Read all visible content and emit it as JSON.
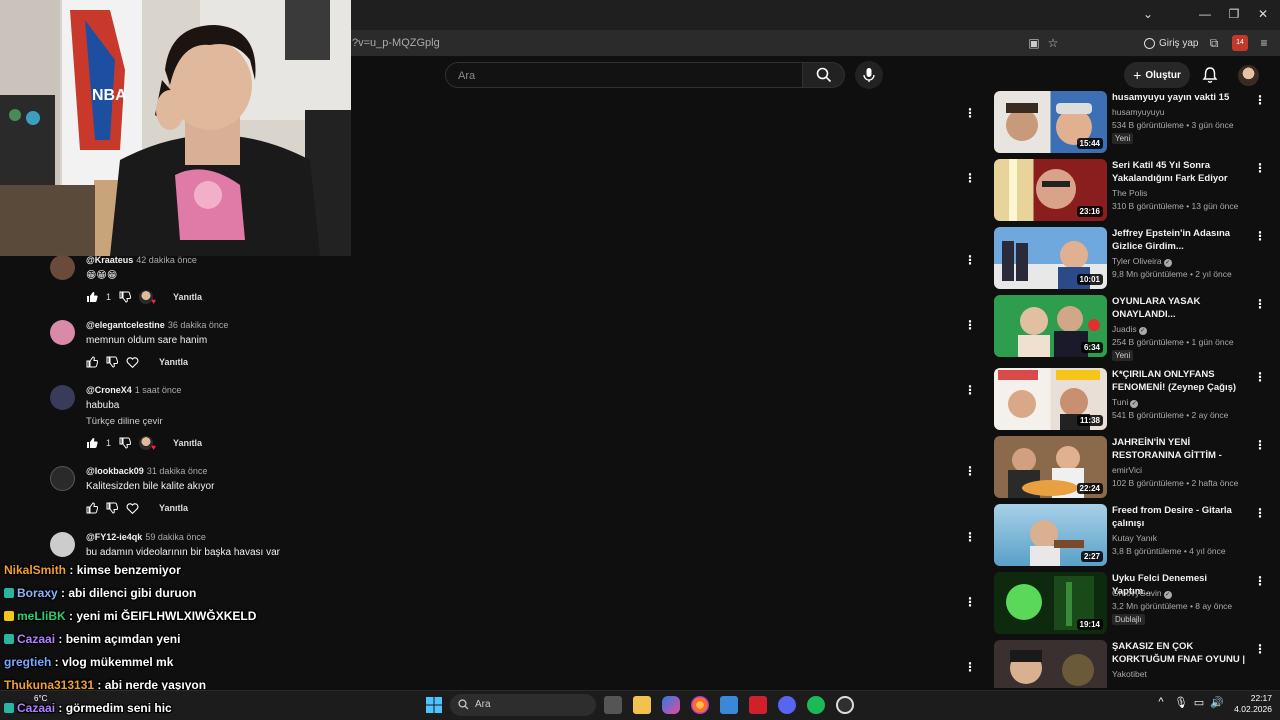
{
  "browser": {
    "url": "?v=u_p-MQZGplg",
    "signin_label": "Giriş yap",
    "extension_badge": "14"
  },
  "youtube": {
    "search_placeholder": "Ara",
    "create_label": "Oluştur"
  },
  "comments": [
    {
      "author": "@Kraateus",
      "time": "42 dakika önce",
      "text": "😁😁😁",
      "text2": "",
      "likes": "1",
      "reply_label": "Yanıtla",
      "creator_heart": true,
      "avatar_color": "#6a4a3a"
    },
    {
      "author": "@elegantcelestine",
      "time": "36 dakika önce",
      "text": "memnun oldum sare hanim",
      "text2": "",
      "likes": "",
      "reply_label": "Yanıtla",
      "creator_heart": false,
      "avatar_color": "#d98aa8"
    },
    {
      "author": "@CroneX4",
      "time": "1 saat önce",
      "text": "habuba",
      "text2": "Türkçe diline çevir",
      "likes": "1",
      "reply_label": "Yanıtla",
      "creator_heart": true,
      "avatar_color": "#3a3a5a"
    },
    {
      "author": "@lookback09",
      "time": "31 dakika önce",
      "text": "Kalitesizden bile kalite akıyor",
      "text2": "",
      "likes": "",
      "reply_label": "Yanıtla",
      "creator_heart": false,
      "avatar_color": "#2a2a2a"
    },
    {
      "author": "@FY12-ie4qk",
      "time": "59 dakika önce",
      "text": "bu adamın videolarının bir başka havası var",
      "text2": "",
      "likes": "",
      "reply_label": "Yanıtla",
      "creator_heart": false,
      "avatar_color": "#cccccc"
    }
  ],
  "stream_chat": [
    {
      "user": "NikalSmith",
      "message": "kimse benzemiyor",
      "color": "#f0a030",
      "badge": ""
    },
    {
      "user": "Boraxy",
      "message": "abi dilenci gibi duruon",
      "color": "#8ab4f8",
      "badge": "#2bb5a0"
    },
    {
      "user": "meLIiBK",
      "message": "yeni mi ĞEIFLHWLXIWĞXKELD",
      "color": "#2ecc71",
      "badge": "#f5c518"
    },
    {
      "user": "Cazaai",
      "message": "benim açımdan yeni",
      "color": "#b080ff",
      "badge": "#2bb5a0"
    },
    {
      "user": "gregtieh",
      "message": "vlog mükemmel mk",
      "color": "#7aa7ff",
      "badge": ""
    },
    {
      "user": "Thukuna313131",
      "message": "abi nerde yaşıyon",
      "color": "#f0a030",
      "badge": ""
    },
    {
      "user": "Cazaai",
      "message": "görmedim seni hic",
      "color": "#b080ff",
      "badge": "#2bb5a0"
    }
  ],
  "sidebar_videos": [
    {
      "title": "husamyuyu yayın vakti 15",
      "channel": "husamyuyuyu",
      "verified": false,
      "meta": "534 B görüntüleme • 3 gün önce",
      "badge": "Yeni",
      "duration": "15:44",
      "thumb_color": "#3d6fb5"
    },
    {
      "title": "Seri Katil 45 Yıl Sonra Yakalandığını Fark Ediyor",
      "channel": "The Polis",
      "verified": false,
      "meta": "310 B görüntüleme • 13 gün önce",
      "badge": "",
      "duration": "23:16",
      "thumb_color": "#8a1e1e"
    },
    {
      "title": "Jeffrey Epstein'in Adasına Gizlice Girdim...",
      "channel": "Tyler Oliveira",
      "verified": true,
      "meta": "9,8 Mn görüntüleme • 2 yıl önce",
      "badge": "",
      "duration": "10:01",
      "thumb_color": "#6fa8dc"
    },
    {
      "title": "OYUNLARA YASAK ONAYLANDI...",
      "channel": "Juadis",
      "verified": true,
      "meta": "254 B görüntüleme • 1 gün önce",
      "badge": "Yeni",
      "duration": "6:34",
      "thumb_color": "#2e9e4e"
    },
    {
      "title": "K*ÇIRILAN ONLYFANS FENOMENİ! (Zeynep Çağış)",
      "channel": "Tuni",
      "verified": true,
      "meta": "541 B görüntüleme • 2 ay önce",
      "badge": "",
      "duration": "11:38",
      "thumb_color": "#d94a4a"
    },
    {
      "title": "JAHREİN'İN YENİ RESTORANINA GİTTİM - pahal...",
      "channel": "emirVici",
      "verified": false,
      "meta": "102 B görüntüleme • 2 hafta önce",
      "badge": "",
      "duration": "22:24",
      "thumb_color": "#b07040"
    },
    {
      "title": "Freed from Desire - Gitarla çalınışı",
      "channel": "Kutay Yanık",
      "verified": false,
      "meta": "3,8 B görüntüleme • 4 yıl önce",
      "badge": "",
      "duration": "2:27",
      "thumb_color": "#5aa0c8"
    },
    {
      "title": "Uyku Felci Denemesi Yaptım...",
      "channel": "GroovyGavin",
      "verified": true,
      "meta": "3,2 Mn görüntüleme • 8 ay önce",
      "badge": "Dublajlı",
      "duration": "19:14",
      "thumb_color": "#1a5a1a"
    },
    {
      "title": "ŞAKASIZ EN ÇOK KORKTUĞUM FNAF OYUNU | Those Nights a...",
      "channel": "Yakotibet",
      "verified": false,
      "meta": "",
      "badge": "",
      "duration": "",
      "thumb_color": "#3a3030"
    }
  ],
  "taskbar": {
    "search_label": "Ara",
    "weather": "6°C",
    "time": "22:17",
    "date": "4.02.2026"
  }
}
